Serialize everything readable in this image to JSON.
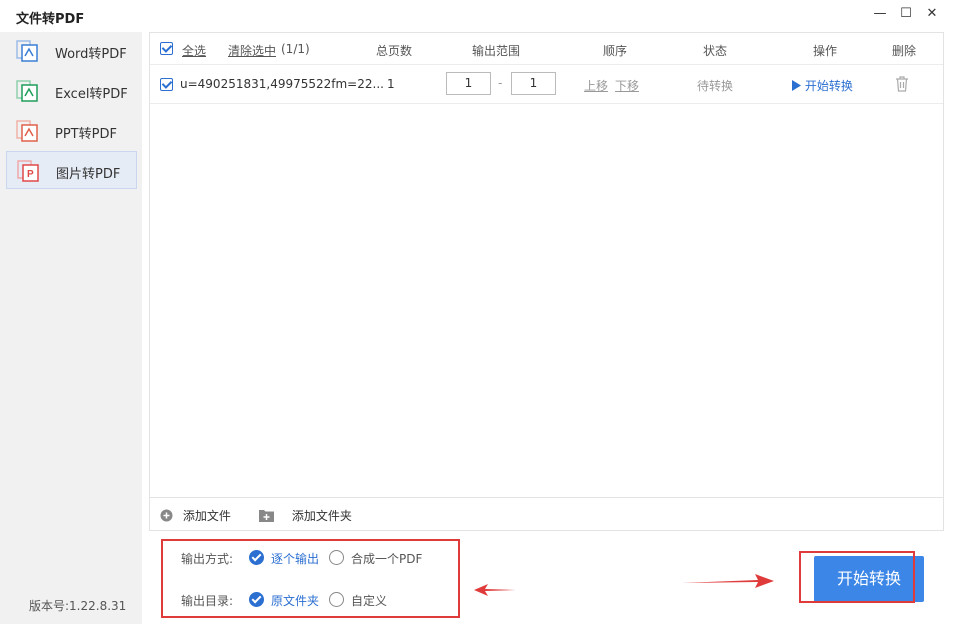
{
  "app": {
    "title": "文件转PDF"
  },
  "window_controls": {
    "minimize": "—",
    "maximize": "☐",
    "close": "✕"
  },
  "sidebar": {
    "items": [
      {
        "label": "Word转PDF",
        "icon": "word-doc-icon",
        "color": "#3a7fd5"
      },
      {
        "label": "Excel转PDF",
        "icon": "excel-doc-icon",
        "color": "#1f9e5a"
      },
      {
        "label": "PPT转PDF",
        "icon": "ppt-doc-icon",
        "color": "#e0604c"
      },
      {
        "label": "图片转PDF",
        "icon": "image-pdf-icon",
        "color": "#e04848"
      }
    ],
    "active_index": 3
  },
  "version": "版本号:1.22.8.31",
  "table": {
    "select_all": "全选",
    "clear_selection": "清除选中",
    "count": "(1/1)",
    "headers": [
      "总页数",
      "输出范围",
      "顺序",
      "状态",
      "操作",
      "删除"
    ],
    "rows": [
      {
        "filename": "u=490251831,49975522fm=22...",
        "pages": "1",
        "range_from": "1",
        "range_sep": "-",
        "range_to": "1",
        "move_up": "上移",
        "move_down": "下移",
        "status": "待转换",
        "action": "开始转换"
      }
    ]
  },
  "footer": {
    "add_file": "添加文件",
    "add_folder": "添加文件夹"
  },
  "options": {
    "output_mode_label": "输出方式:",
    "output_mode_a": "逐个输出",
    "output_mode_b": "合成一个PDF",
    "output_dir_label": "输出目录:",
    "output_dir_a": "原文件夹",
    "output_dir_b": "自定义"
  },
  "start_button": "开始转换",
  "colors": {
    "accent": "#3b86e6",
    "annotation_red": "#e03b3b"
  }
}
